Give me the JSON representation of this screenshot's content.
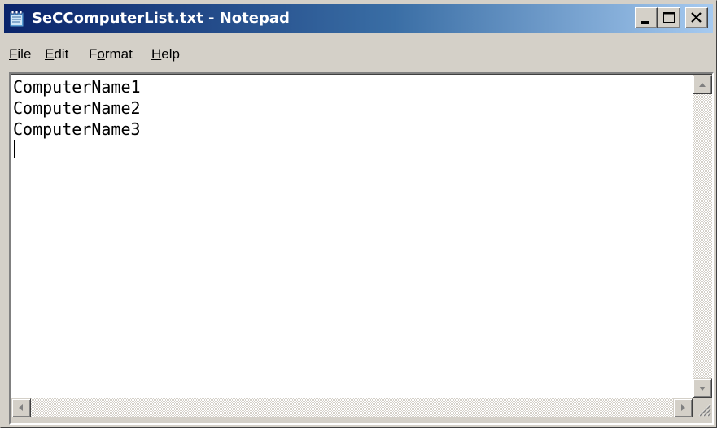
{
  "window": {
    "title": "SeCComputerList.txt - Notepad",
    "app_icon": "notepad-icon",
    "controls": {
      "minimize_icon": "minimize-icon",
      "maximize_icon": "maximize-icon",
      "close_icon": "close-icon"
    }
  },
  "menu": {
    "items": [
      {
        "accel": "F",
        "rest": "ile"
      },
      {
        "accel": "E",
        "rest": "dit"
      },
      {
        "pre": "F",
        "accel": "o",
        "rest": "rmat"
      },
      {
        "accel": "H",
        "rest": "elp"
      }
    ]
  },
  "editor": {
    "lines": [
      "ComputerName1",
      "ComputerName2",
      "ComputerName3"
    ]
  },
  "scrollbars": {
    "up_icon": "arrow-up-icon",
    "down_icon": "arrow-down-icon",
    "left_icon": "arrow-left-icon",
    "right_icon": "arrow-right-icon",
    "grip_icon": "resize-grip-icon"
  },
  "colors": {
    "titlebar_start": "#0a246a",
    "titlebar_end": "#a6caf0",
    "chrome": "#d4d0c8"
  }
}
